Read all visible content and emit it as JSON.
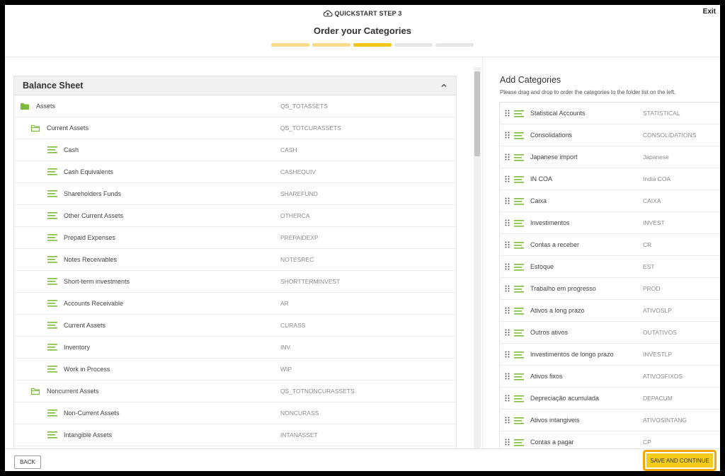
{
  "header": {
    "step_label": "QUICKSTART STEP 3",
    "title": "Order your Categories",
    "exit_label": "Exit",
    "progress": {
      "total_steps": 5,
      "current_step": 3,
      "colors": [
        "#f7dd8a",
        "#f7dd8a",
        "#f5c518",
        "#e6e6e6",
        "#e6e6e6"
      ]
    }
  },
  "left_panel": {
    "section_title": "Balance Sheet",
    "rows": [
      {
        "name": "Assets",
        "code": "QS_TOTASSETS",
        "level": 0,
        "icon": "folder-filled-icon"
      },
      {
        "name": "Current Assets",
        "code": "QS_TOTCURASSETS",
        "level": 1,
        "icon": "folder-outline-icon"
      },
      {
        "name": "Cash",
        "code": "CASH",
        "level": 2,
        "icon": "lines-icon"
      },
      {
        "name": "Cash Equivalents",
        "code": "CASHEQUIV",
        "level": 2,
        "icon": "lines-icon"
      },
      {
        "name": "Shareholders Funds",
        "code": "SHAREFUND",
        "level": 2,
        "icon": "lines-icon"
      },
      {
        "name": "Other Current Assets",
        "code": "OTHERCA",
        "level": 2,
        "icon": "lines-icon"
      },
      {
        "name": "Prepaid Expenses",
        "code": "PREPAIDEXP",
        "level": 2,
        "icon": "lines-icon"
      },
      {
        "name": "Notes Receivables",
        "code": "NOTESREC",
        "level": 2,
        "icon": "lines-icon"
      },
      {
        "name": "Short-term investments",
        "code": "SHORTTERMINVEST",
        "level": 2,
        "icon": "lines-icon"
      },
      {
        "name": "Accounts Receivable",
        "code": "AR",
        "level": 2,
        "icon": "lines-icon"
      },
      {
        "name": "Current Assets",
        "code": "CURASS",
        "level": 2,
        "icon": "lines-icon"
      },
      {
        "name": "Inventory",
        "code": "INV",
        "level": 2,
        "icon": "lines-icon"
      },
      {
        "name": "Work in Process",
        "code": "WIP",
        "level": 2,
        "icon": "lines-icon"
      },
      {
        "name": "Noncurrent Assets",
        "code": "QS_TOTNONCURASSETS",
        "level": 1,
        "icon": "folder-outline-icon"
      },
      {
        "name": "Non-Current Assets",
        "code": "NONCURASS",
        "level": 2,
        "icon": "lines-icon"
      },
      {
        "name": "Intangible Assets",
        "code": "INTANASSET",
        "level": 2,
        "icon": "lines-icon"
      },
      {
        "name": "",
        "code": "",
        "level": 2,
        "icon": "lines-icon"
      }
    ]
  },
  "right_panel": {
    "title": "Add Categories",
    "description": "Please drag and drop to order the categories to the folder list on the left.",
    "items": [
      {
        "name": "Statistical Accounts",
        "code": "STATISTICAL"
      },
      {
        "name": "Consolidations",
        "code": "CONSOLIDATIONS"
      },
      {
        "name": "Japanese import",
        "code": "Japanese"
      },
      {
        "name": "IN COA",
        "code": "India COA"
      },
      {
        "name": "Caixa",
        "code": "CAIXA"
      },
      {
        "name": "Investimentos",
        "code": "INVEST"
      },
      {
        "name": "Contas a receber",
        "code": "CR"
      },
      {
        "name": "Estoque",
        "code": "EST"
      },
      {
        "name": "Trabalho em progresso",
        "code": "PROD"
      },
      {
        "name": "Ativos a long prazo",
        "code": "ATIVOSLP"
      },
      {
        "name": "Outros ativos",
        "code": "OUTATIVOS"
      },
      {
        "name": "Investimentos de longo prazo",
        "code": "INVESTLP"
      },
      {
        "name": "Ativos fixos",
        "code": "ATIVOSFIXOS"
      },
      {
        "name": "Depreciação acumulada",
        "code": "DEPACUM"
      },
      {
        "name": "Ativos intangiveis",
        "code": "ATIVOSINTANG"
      },
      {
        "name": "Contas a pagar",
        "code": "CP"
      }
    ]
  },
  "footer": {
    "back_label": "BACK",
    "save_label": "SAVE AND CONTINUE"
  },
  "colors": {
    "accent_green": "#7dbb3c",
    "accent_yellow": "#f5c518",
    "highlight_orange": "#f5a800"
  }
}
